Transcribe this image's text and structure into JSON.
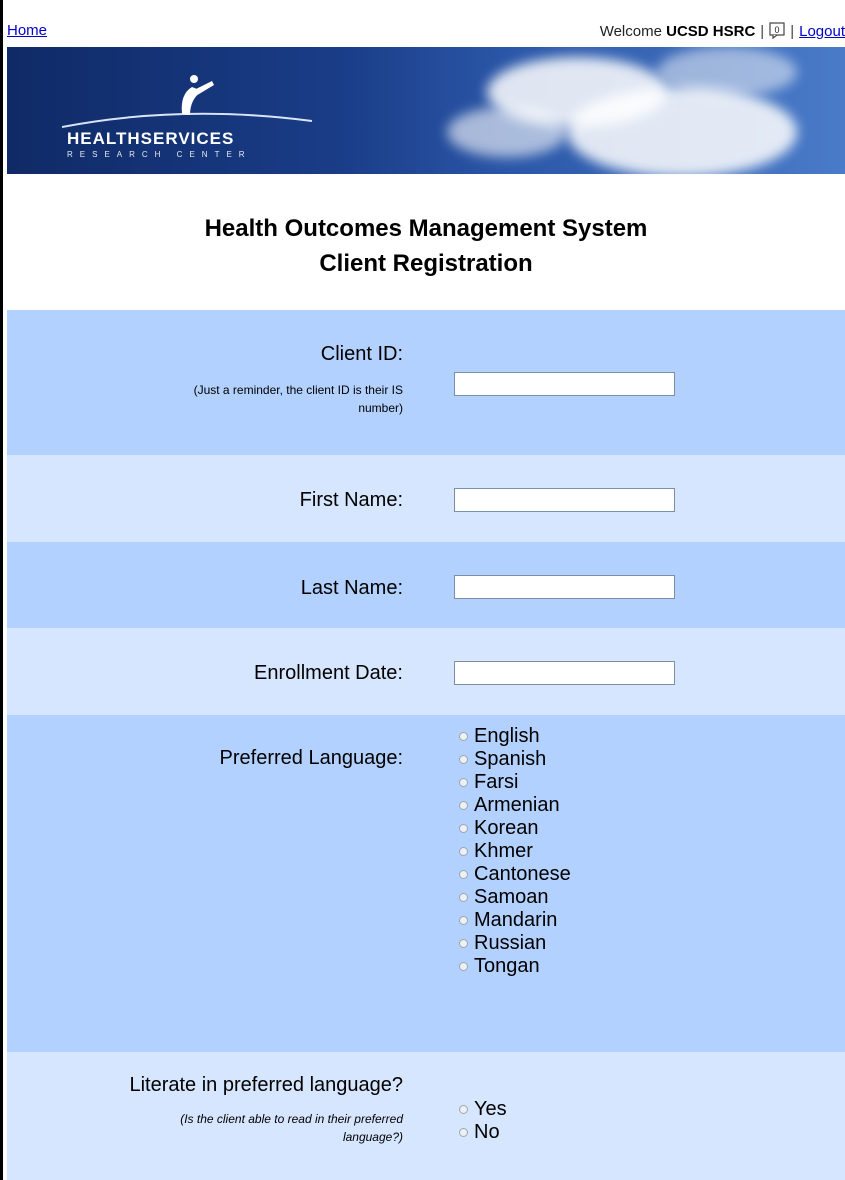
{
  "topbar": {
    "home_link": "Home",
    "welcome_prefix": "Welcome",
    "username": "UCSD HSRC",
    "message_icon": "message-icon",
    "logout_link": "Logout"
  },
  "banner": {
    "logo_main": "HEALTHSERVICES",
    "logo_sub": "RESEARCH CENTER"
  },
  "page": {
    "title": "Health Outcomes Management System",
    "subtitle": "Client Registration"
  },
  "form": {
    "client_id": {
      "label": "Client ID:",
      "hint_line1": "(Just a reminder, the client ID is their IS",
      "hint_line2": "number)",
      "value": ""
    },
    "first_name": {
      "label": "First Name:",
      "value": ""
    },
    "last_name": {
      "label": "Last Name:",
      "value": ""
    },
    "enrollment_date": {
      "label": "Enrollment Date:",
      "value": ""
    },
    "preferred_language": {
      "label": "Preferred Language:",
      "options": [
        "English",
        "Spanish",
        "Farsi",
        "Armenian",
        "Korean",
        "Khmer",
        "Cantonese",
        "Samoan",
        "Mandarin",
        "Russian",
        "Tongan"
      ]
    },
    "literate": {
      "label": "Literate in preferred language?",
      "hint_line1": "(Is the client able to read in their preferred",
      "hint_line2": "language?)",
      "options": [
        "Yes",
        "No"
      ]
    }
  },
  "colors": {
    "row_dark": "#b3d1ff",
    "row_light": "#d6e6ff",
    "banner_dark": "#0f2a66",
    "link": "#0000cc"
  }
}
